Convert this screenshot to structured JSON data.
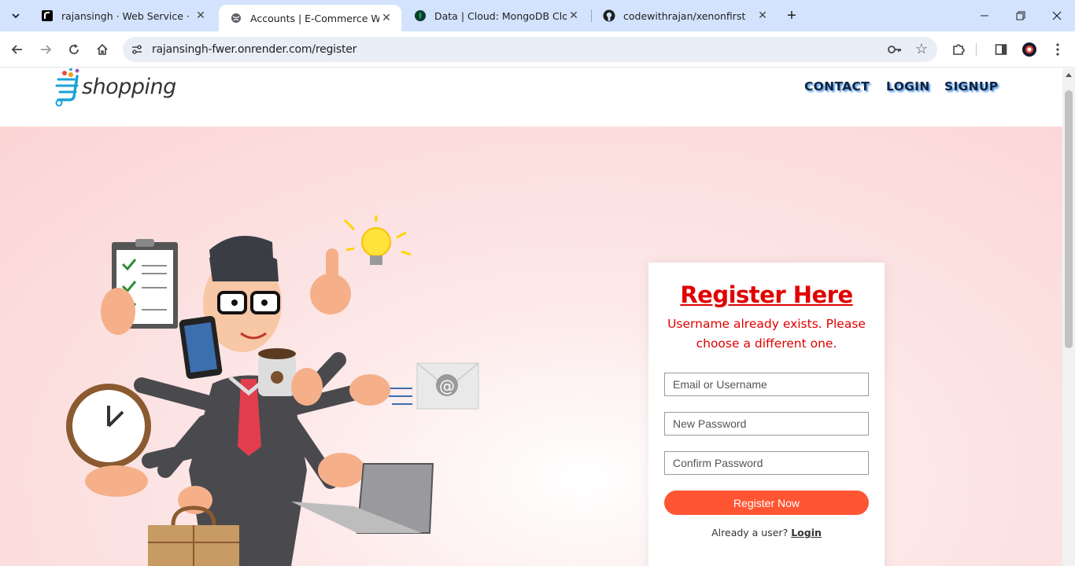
{
  "browser": {
    "tabs": [
      {
        "title": "rajansingh · Web Service · Ren",
        "icon": "render-icon"
      },
      {
        "title": "Accounts | E-Commerce Websit",
        "icon": "globe-icon"
      },
      {
        "title": "Data | Cloud: MongoDB Cloud",
        "icon": "mongodb-leaf-icon"
      },
      {
        "title": "codewithrajan/xenonfirst",
        "icon": "github-icon"
      }
    ],
    "active_tab": 1,
    "url": "rajansingh-fwer.onrender.com/register"
  },
  "site": {
    "logo_text": "shopping",
    "nav": [
      "CONTACT",
      "LOGIN",
      "SIGNUP"
    ]
  },
  "form": {
    "title": "Register Here",
    "message": "Username already exists. Please choose a different one.",
    "email_placeholder": "Email or Username",
    "password_placeholder": "New Password",
    "confirm_placeholder": "Confirm Password",
    "submit_label": "Register Now",
    "already_text": "Already a user?",
    "login_link": "Login"
  },
  "colors": {
    "title_red": "#e00000",
    "button": "#ff5533",
    "nav_text": "#0f2342",
    "hero_bg": "#fbd4d4"
  }
}
